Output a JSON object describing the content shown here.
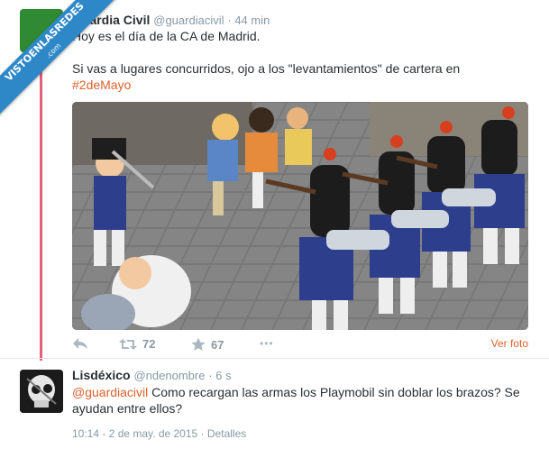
{
  "watermark": {
    "text": "VISTOENLASREDES",
    "sub": ".com"
  },
  "tweet1": {
    "name": "Guardia Civil",
    "handle": "@guardiacivil",
    "time": "· 44 min",
    "line1": "Hoy es el día de la CA de Madrid.",
    "line2": "Si vas a lugares concurridos, ojo a los \"levantamientos\" de cartera en",
    "hashtag": "#2deMayo",
    "retweets": "72",
    "favorites": "67",
    "more": "•••",
    "view_photo": "Ver foto"
  },
  "tweet2": {
    "name": "Lisdéxico",
    "handle": "@ndenombre",
    "time": "· 6 s",
    "mention": "@guardiacivil",
    "text": " Como recargan las armas los Playmobil sin doblar los brazos? Se ayudan entre ellos?",
    "timestamp": "10:14 - 2 de may. de 2015",
    "sep": " · ",
    "details": "Detalles"
  },
  "colors": {
    "accent": "#e0602b",
    "thread": "#e1607a",
    "muted": "#8899a6",
    "ribbon": "#2e88c8"
  },
  "icons": [
    "reply-icon",
    "retweet-icon",
    "star-icon",
    "more-icon"
  ]
}
